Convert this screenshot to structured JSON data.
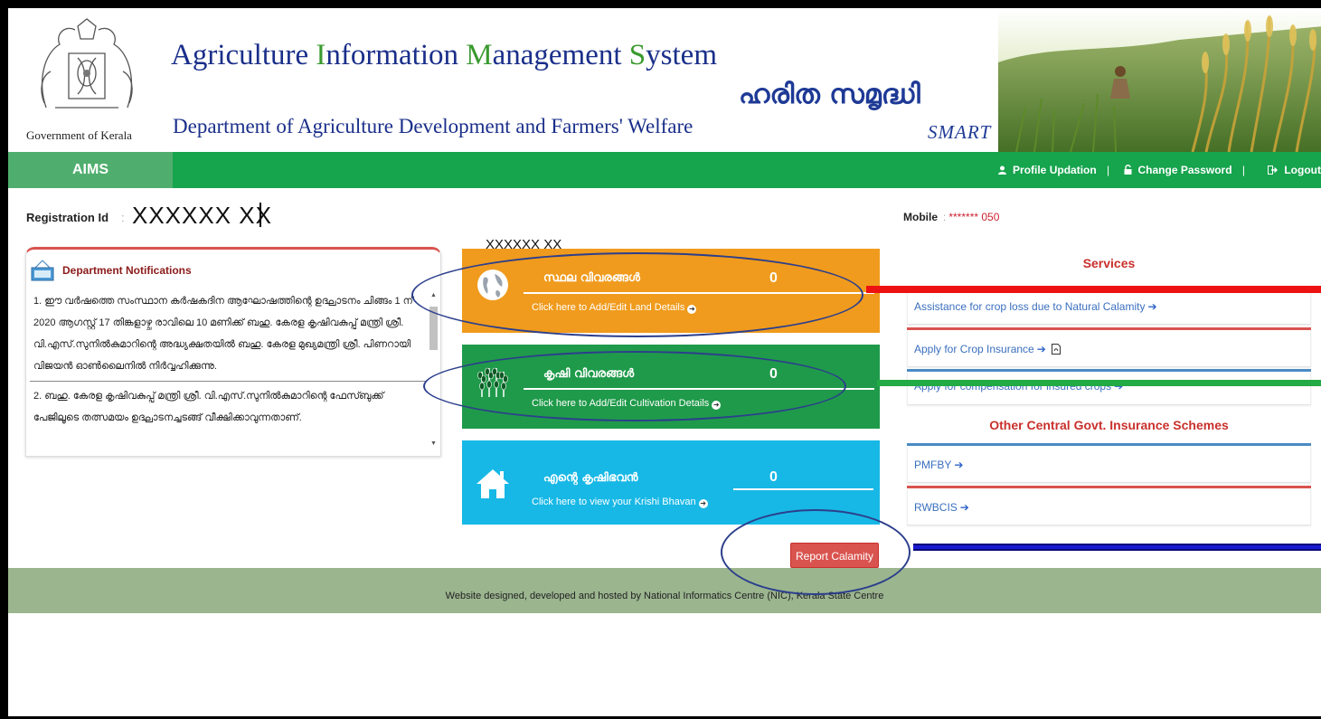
{
  "header": {
    "title_parts": [
      {
        "text": "A",
        "accent": false
      },
      {
        "text": "griculture ",
        "accent": false
      },
      {
        "text": "I",
        "accent": true
      },
      {
        "text": "nformation ",
        "accent": false
      },
      {
        "text": "M",
        "accent": true
      },
      {
        "text": "anagement ",
        "accent": false
      },
      {
        "text": "S",
        "accent": true
      },
      {
        "text": "ystem",
        "accent": false
      }
    ],
    "subtitle": "Department of Agriculture Development and Farmers' Welfare",
    "government_label": "Government of Kerala",
    "scheme_name": "ഹരിത സമൃദ്ധി",
    "scheme_tag": "SMART",
    "colors": {
      "title": "#1a2f8a",
      "accent": "#3a9a2f"
    }
  },
  "nav": {
    "brand": "AIMS",
    "links": [
      {
        "label": "Profile Updation",
        "icon": "user-icon"
      },
      {
        "label": "Change Password",
        "icon": "lock-icon"
      },
      {
        "label": "Logout",
        "icon": "logout-icon"
      }
    ],
    "color": "#16a44d"
  },
  "info": {
    "registration_label": "Registration Id",
    "registration_value": "XXXXXX XX",
    "name_value": "XXXXXX XX",
    "mobile_label": "Mobile",
    "mobile_value": "******* 050"
  },
  "notifications": {
    "title": "Department Notifications",
    "items": [
      "1. ഈ വർഷത്തെ സംസ്ഥാന കർഷകദിന ആഘോഷത്തിന്റെ ഉദ്ഘാടനം ചിങ്ങം 1 ന് 2020 ആഗസ്റ്റ് 17 തിങ്കളാഴ്ച രാവിലെ 10 മണിക്ക് ബഹു. കേരള കൃഷിവകുപ്പ് മന്ത്രി ശ്രീ. വി.എസ്.സുനിൽകുമാറിന്റെ അദ്ധ്യക്ഷതയിൽ ബഹു. കേരള മുഖ്യമന്ത്രി ശ്രീ. പിണറായി വിജയൻ ഓൺലൈനിൽ നിർവ്വഹിക്കുന്നു.",
      "2. ബഹു. കേരള കൃഷിവകുപ്പ് മന്ത്രി ശ്രീ. വി.എസ്.സുനിൽകുമാറിന്റെ ഫേസ്ബുക്ക് പേജിലൂടെ തത്സമയം ഉദ്ഘാടനച്ചടങ്ങ് വീക്ഷിക്കാവുന്നതാണ്."
    ]
  },
  "tiles": [
    {
      "label": "സ്ഥല വിവരങ്ങൾ",
      "count": "0",
      "link": "Click here to Add/Edit Land Details",
      "icon": "globe-icon",
      "color": "#f09b1d"
    },
    {
      "label": "കൃഷി വിവരങ്ങൾ",
      "count": "0",
      "link": "Click here to Add/Edit Cultivation Details",
      "icon": "crop-icon",
      "color": "#1f9a4a"
    },
    {
      "label": "എന്റെ കൃഷിഭവൻ",
      "count": "0",
      "link": "Click here to view your Krishi Bhavan",
      "icon": "home-icon",
      "color": "#17b8e6"
    }
  ],
  "report_button": "Report Calamity",
  "services": {
    "title": "Services",
    "items": [
      {
        "label": "Assistance for crop loss due to Natural Calamity",
        "pdf": false
      },
      {
        "label": "Apply for Crop Insurance",
        "pdf": true
      },
      {
        "label": "Apply for compensation for insured crops",
        "pdf": false
      }
    ],
    "other_title": "Other Central Govt. Insurance Schemes",
    "other_items": [
      {
        "label": "PMFBY"
      },
      {
        "label": "RWBCIS"
      }
    ]
  },
  "footer": {
    "text": "Website designed, developed and hosted by National Informatics Centre (NIC), Kerala State Centre"
  }
}
